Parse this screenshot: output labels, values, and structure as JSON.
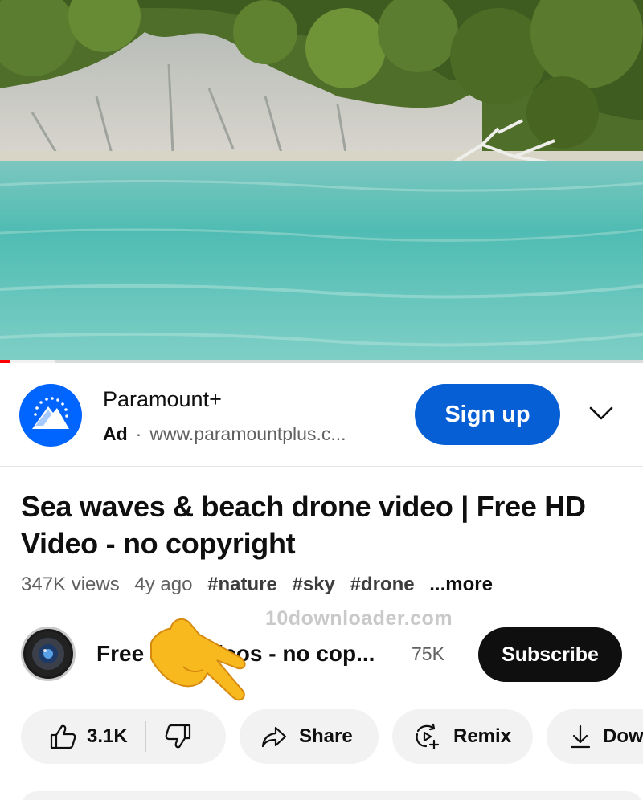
{
  "player": {
    "progress_percent": 1.5,
    "buffered_percent": 8.5
  },
  "ad": {
    "advertiser": "Paramount+",
    "tag": "Ad",
    "separator": "·",
    "url": "www.paramountplus.c...",
    "cta_label": "Sign up",
    "cta_color": "#065fd4",
    "logo_color": "#0064ff",
    "menu_icon": "chevron-down-icon"
  },
  "video": {
    "title": "Sea waves & beach drone video | Free HD Video - no copyright",
    "views": "347K views",
    "age": "4y ago",
    "hashtags": [
      "#nature",
      "#sky",
      "#drone"
    ],
    "more_label": "...more"
  },
  "watermark": "10downloader.com",
  "channel": {
    "name": "Free HD Videos - no cop...",
    "subscribers": "75K",
    "subscribe_label": "Subscribe"
  },
  "actions": {
    "likes": "3.1K",
    "share_label": "Share",
    "remix_label": "Remix",
    "download_label": "Dow",
    "icons": [
      "thumbs-up-icon",
      "thumbs-down-icon",
      "share-icon",
      "remix-icon",
      "download-icon"
    ]
  }
}
